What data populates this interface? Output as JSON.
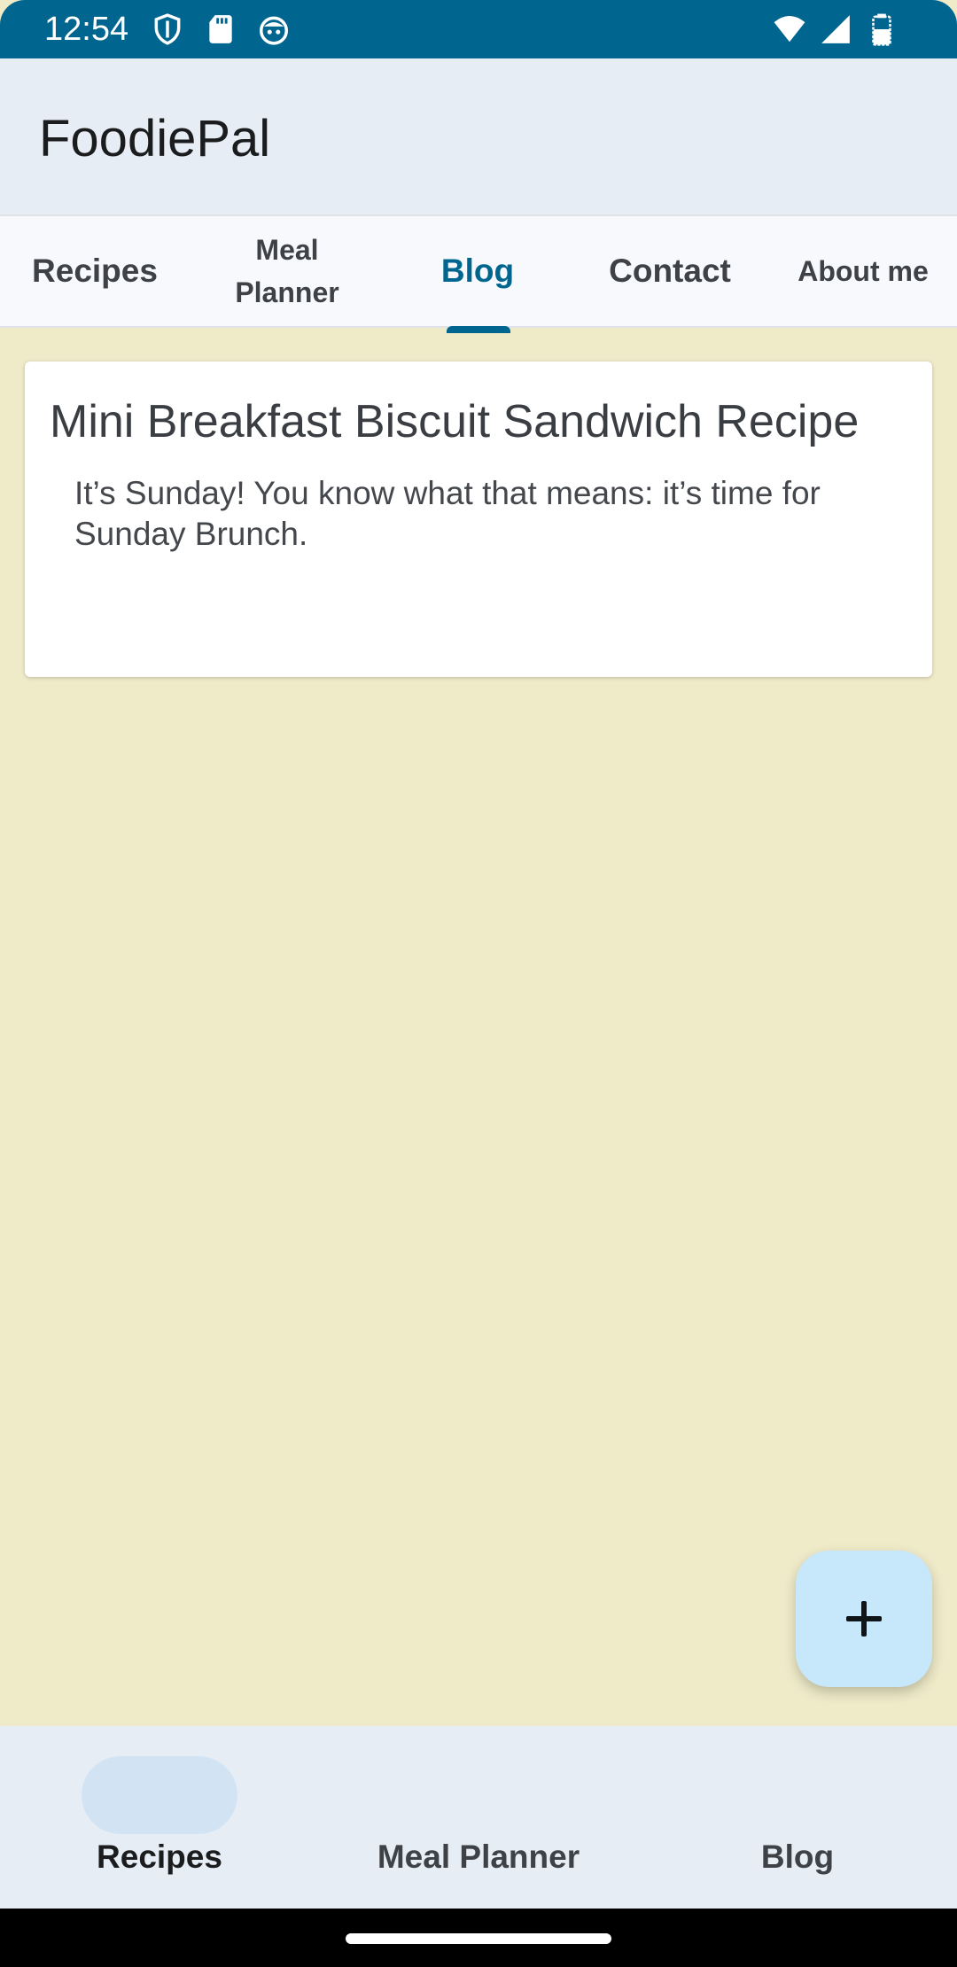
{
  "status_bar": {
    "time": "12:54",
    "left_icons": [
      "shield-icon",
      "sd-card-icon",
      "android-debug-icon"
    ],
    "right_icons": [
      "wifi-icon",
      "cell-signal-icon",
      "battery-icon"
    ]
  },
  "app_bar": {
    "title": "FoodiePal"
  },
  "tabs": [
    {
      "label": "Recipes",
      "selected": false
    },
    {
      "label_line1": "Meal",
      "label_line2": "Planner",
      "selected": false
    },
    {
      "label": "Blog",
      "selected": true
    },
    {
      "label": "Contact",
      "selected": false
    },
    {
      "label": "About me",
      "selected": false
    }
  ],
  "blog_post": {
    "title": "Mini Breakfast Biscuit Sandwich Recipe",
    "excerpt": "It’s Sunday! You know what that means: it’s time for Sunday Brunch."
  },
  "fab": {
    "icon": "plus-icon"
  },
  "bottom_nav": {
    "items": [
      {
        "label": "Recipes",
        "selected": true
      },
      {
        "label": "Meal Planner",
        "selected": false
      },
      {
        "label": "Blog",
        "selected": false
      }
    ]
  },
  "colors": {
    "primary": "#00658f",
    "background": "#efebc9",
    "app_bar": "#e6edf5",
    "fab": "#c7e7fb",
    "nav_pill": "#d2e4f3"
  }
}
